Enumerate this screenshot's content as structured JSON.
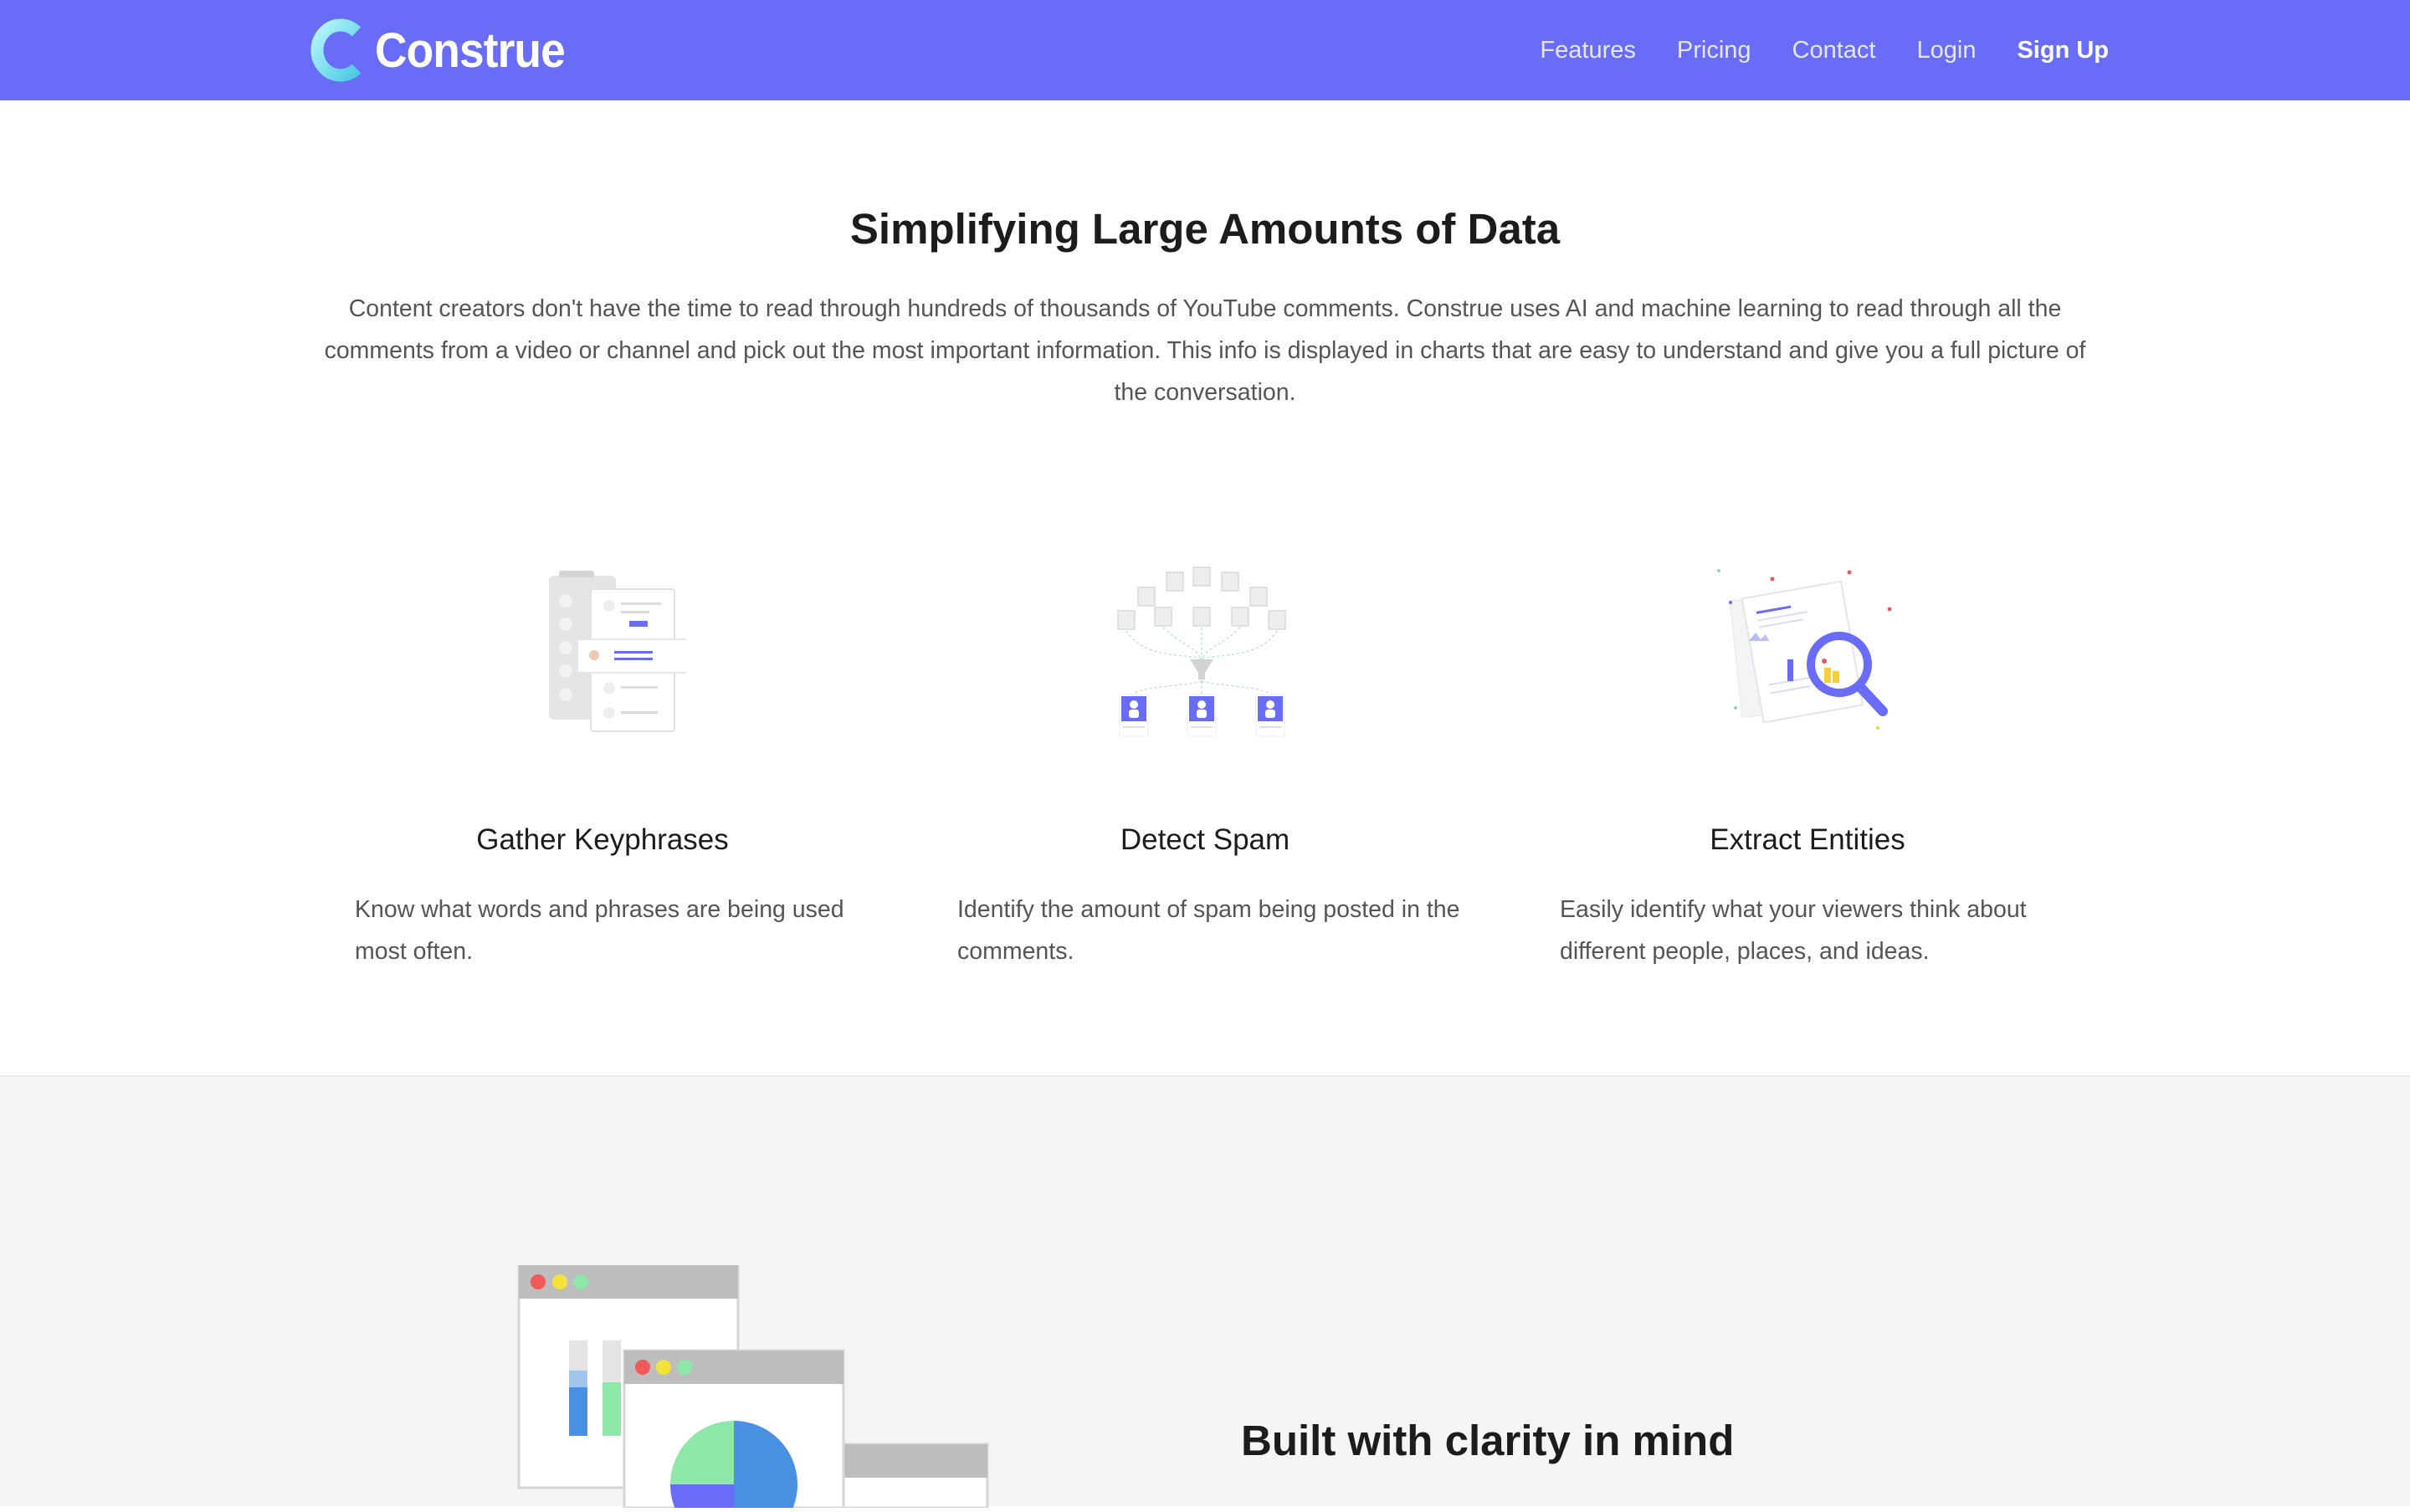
{
  "brand": {
    "name": "Construe",
    "logo_icon": "construe-c-logo"
  },
  "nav": {
    "items": [
      "Features",
      "Pricing",
      "Contact",
      "Login"
    ],
    "signup": "Sign Up"
  },
  "hero": {
    "title": "Simplifying Large Amounts of Data",
    "text": "Content creators don't have the time to read through hundreds of thousands of YouTube comments. Construe uses AI and machine learning to read through all the comments from a video or channel and pick out the most important information. This info is displayed in charts that are easy to understand and give you a full picture of the conversation."
  },
  "features": [
    {
      "icon": "keyphrases-illustration",
      "title": "Gather Keyphrases",
      "desc": "Know what words and phrases are being used most often."
    },
    {
      "icon": "spam-filter-illustration",
      "title": "Detect Spam",
      "desc": "Identify the amount of spam being posted in the comments."
    },
    {
      "icon": "entity-search-illustration",
      "title": "Extract Entities",
      "desc": "Easily identify what your viewers think about different people, places, and ideas."
    }
  ],
  "clarity": {
    "title": "Built with clarity in mind",
    "icon": "chart-windows-illustration"
  },
  "colors": {
    "accent": "#696cf6",
    "section_bg": "#f5f5f5",
    "logo_gradient_start": "#9ef0ff",
    "logo_gradient_end": "#56d2e9"
  }
}
